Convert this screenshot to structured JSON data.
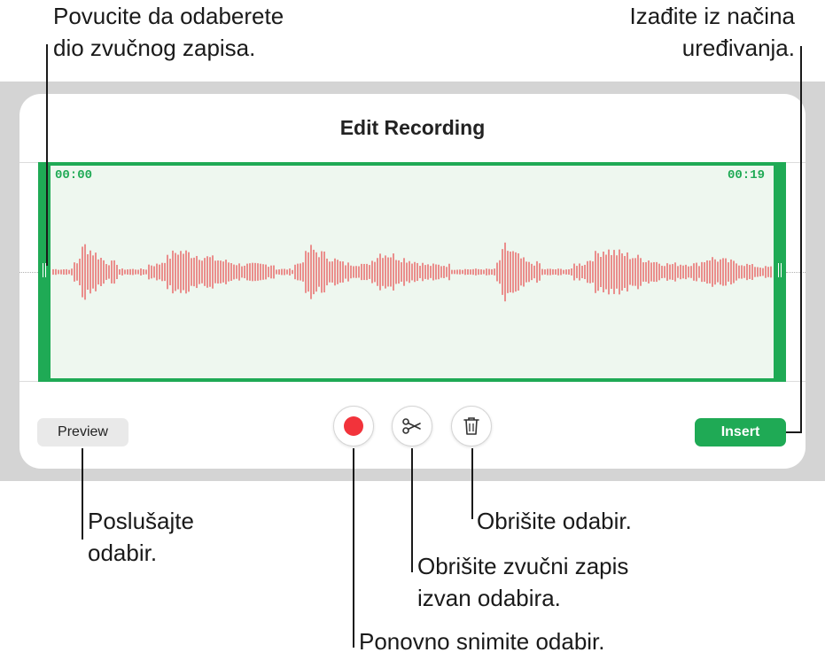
{
  "dialog": {
    "title": "Edit Recording",
    "start_time": "00:00",
    "end_time": "00:19",
    "preview_label": "Preview",
    "insert_label": "Insert"
  },
  "tools": {
    "record_icon": "record-icon",
    "trim_icon": "scissors-icon",
    "delete_icon": "trash-icon"
  },
  "callouts": {
    "drag_select_1": "Povucite da odaberete",
    "drag_select_2": "dio zvučnog zapisa.",
    "exit_edit_1": "Izađite iz načina",
    "exit_edit_2": "uređivanja.",
    "preview_1": "Poslušajte",
    "preview_2": "odabir.",
    "delete_1": "Obrišite odabir.",
    "trim_1": "Obrišite zvučni zapis",
    "trim_2": "izvan odabira.",
    "rerecord_1": "Ponovno snimite odabir."
  },
  "colors": {
    "accent": "#1faa55",
    "waveform": "#e8494a",
    "record": "#f2333b"
  }
}
